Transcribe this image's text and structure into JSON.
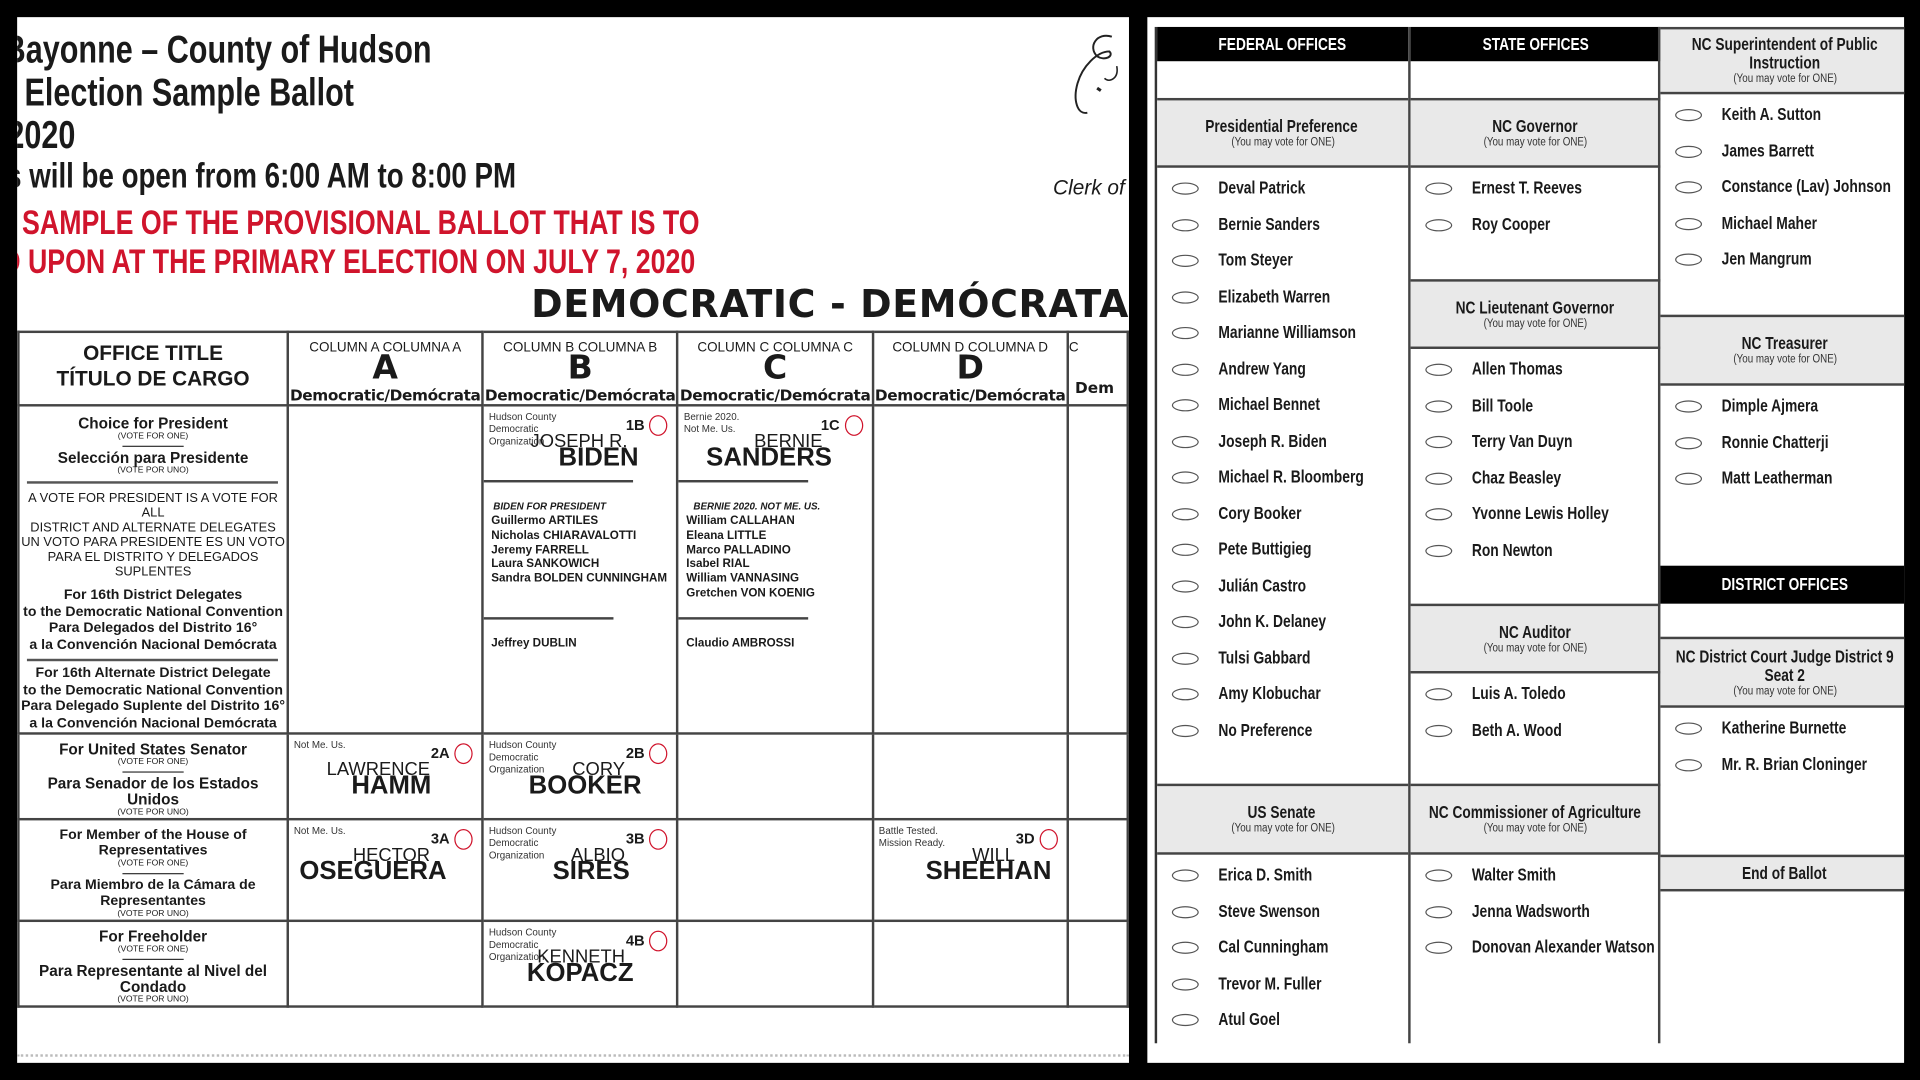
{
  "document_header": {
    "title_line_1": "Bayonne – County of Hudson",
    "title_line_2": "Election Sample Ballot",
    "title_line_3": "2020",
    "polls_line": "s will be open from 6:00 AM to 8:00 PM",
    "notice_line_1": "SAMPLE OF THE PROVISIONAL BALLOT THAT IS TO",
    "notice_line_2": "D UPON AT THE PRIMARY ELECTION ON JULY 7, 2020",
    "party_banner": "DEMOCRATIC - DEMÓCRATA",
    "clerk_label": "Clerk of",
    "signature": "E"
  },
  "colors": {
    "notice_red": "#d0142c",
    "header_black": "#000000",
    "section_gray": "#e9e9e9"
  },
  "nj_ballot": {
    "office_header": [
      "OFFICE TITLE",
      "TÍTULO DE CARGO"
    ],
    "columns": [
      {
        "label": "COLUMN A COLUMNA A",
        "letter": "A",
        "party": "Democratic/Demócrata"
      },
      {
        "label": "COLUMN B COLUMNA B",
        "letter": "B",
        "party": "Democratic/Demócrata"
      },
      {
        "label": "COLUMN C COLUMNA C",
        "letter": "C",
        "party": "Democratic/Demócrata"
      },
      {
        "label": "COLUMN D COLUMNA D",
        "letter": "D",
        "party": "Democratic/Demócrata"
      },
      {
        "label": "C",
        "letter": "",
        "party": "Dem"
      }
    ],
    "president": {
      "title_en": "Choice for President",
      "vote_en": "(VOTE FOR ONE)",
      "title_es": "Selección para Presidente",
      "vote_es": "(VOTE POR UNO)",
      "notice": [
        "A VOTE FOR PRESIDENT IS A VOTE FOR ALL",
        "DISTRICT AND ALTERNATE DELEGATES",
        "UN VOTO PARA PRESIDENTE ES UN VOTO",
        "PARA EL DISTRITO Y DELEGADOS SUPLENTES"
      ],
      "delegates": [
        "For 16th District Delegates",
        "to the Democratic National Convention",
        "Para Delegados del Distrito 16°",
        "a la Convención Nacional Demócrata"
      ],
      "alternates": [
        "For 16th Alternate District Delegate",
        "to the Democratic National Convention",
        "Para Delegado Suplente del Distrito 16°",
        "a la Convención Nacional Demócrata"
      ],
      "biden": {
        "slogan": [
          "Hudson County",
          "Democratic",
          "Organization"
        ],
        "number": "1B",
        "first": "JOSEPH R.",
        "last": "BIDEN",
        "slate_title": "BIDEN FOR PRESIDENT",
        "delegates": [
          "Guillermo ARTILES",
          "Nicholas CHIARAVALOTTI",
          "Jeremy FARRELL",
          "Laura SANKOWICH",
          "Sandra BOLDEN CUNNINGHAM"
        ],
        "alternate": "Jeffrey DUBLIN"
      },
      "sanders": {
        "slogan": [
          "Bernie 2020.",
          "Not Me. Us."
        ],
        "number": "1C",
        "first": "BERNIE",
        "last": "SANDERS",
        "slate_title": "BERNIE 2020. NOT ME. US.",
        "delegates": [
          "William CALLAHAN",
          "Eleana LITTLE",
          "Marco PALLADINO",
          "Isabel RIAL",
          "William VANNASING",
          "Gretchen VON KOENIG"
        ],
        "alternate": "Claudio AMBROSSI"
      }
    },
    "senator": {
      "title_en": "For United States Senator",
      "vote_en": "(VOTE FOR ONE)",
      "title_es": "Para Senador de los Estados Unidos",
      "vote_es": "(VOTE POR UNO)",
      "a": {
        "slogan": [
          "Not Me. Us."
        ],
        "number": "2A",
        "first": "LAWRENCE",
        "last": "HAMM"
      },
      "b": {
        "slogan": [
          "Hudson County",
          "Democratic",
          "Organization"
        ],
        "number": "2B",
        "first": "CORY",
        "last": "BOOKER"
      }
    },
    "house": {
      "title_en": "For Member of the House of Representatives",
      "vote_en": "(VOTE FOR ONE)",
      "title_es": "Para Miembro de la Cámara de Representantes",
      "vote_es": "(VOTE POR UNO)",
      "a": {
        "slogan": [
          "Not Me. Us."
        ],
        "number": "3A",
        "first": "HECTOR",
        "last": "OSEGUERA"
      },
      "b": {
        "slogan": [
          "Hudson County",
          "Democratic",
          "Organization"
        ],
        "number": "3B",
        "first": "ALBIO",
        "last": "SIRES"
      },
      "d": {
        "slogan": [
          "Battle Tested.",
          "Mission Ready."
        ],
        "number": "3D",
        "first": "WILL",
        "last": "SHEEHAN"
      }
    },
    "freeholder": {
      "title_en": "For Freeholder",
      "vote_en": "(VOTE FOR ONE)",
      "title_es": "Para Representante al Nivel del Condado",
      "vote_es": "(VOTE POR UNO)",
      "b": {
        "slogan": [
          "Hudson County",
          "Democratic",
          "Organization"
        ],
        "number": "4B",
        "first": "KENNETH",
        "last": "KOPACZ"
      }
    }
  },
  "nc_ballot": {
    "vote_note": "(You may vote for ONE)",
    "columns": [
      {
        "sections": [
          {
            "type": "black",
            "title": "FEDERAL OFFICES"
          },
          {
            "type": "blank"
          },
          {
            "type": "office",
            "title": "Presidential Preference",
            "candidates": [
              "Deval Patrick",
              "Bernie Sanders",
              "Tom Steyer",
              "Elizabeth Warren",
              "Marianne Williamson",
              "Andrew Yang",
              "Michael Bennet",
              "Joseph R. Biden",
              "Michael R. Bloomberg",
              "Cory Booker",
              "Pete Buttigieg",
              "Julián Castro",
              "John K. Delaney",
              "Tulsi Gabbard",
              "Amy Klobuchar",
              "No Preference"
            ]
          },
          {
            "type": "office",
            "title": "US Senate",
            "candidates": [
              "Erica D. Smith",
              "Steve Swenson",
              "Cal Cunningham",
              "Trevor M. Fuller",
              "Atul Goel"
            ]
          }
        ]
      },
      {
        "sections": [
          {
            "type": "black",
            "title": "STATE OFFICES"
          },
          {
            "type": "blank"
          },
          {
            "type": "office",
            "title": "NC Governor",
            "candidates": [
              "Ernest T. Reeves",
              "Roy Cooper"
            ]
          },
          {
            "type": "office",
            "title": "NC Lieutenant Governor",
            "candidates": [
              "Allen Thomas",
              "Bill Toole",
              "Terry Van Duyn",
              "Chaz Beasley",
              "Yvonne Lewis Holley",
              "Ron Newton"
            ]
          },
          {
            "type": "office",
            "title": "NC Auditor",
            "candidates": [
              "Luis A. Toledo",
              "Beth A. Wood"
            ]
          },
          {
            "type": "office",
            "title": "NC Commissioner of Agriculture",
            "candidates": [
              "Walter Smith",
              "Jenna Wadsworth",
              "Donovan Alexander Watson"
            ]
          }
        ]
      },
      {
        "sections": [
          {
            "type": "office",
            "title": "NC Superintendent of Public Instruction",
            "candidates": [
              "Keith A. Sutton",
              "James Barrett",
              "Constance (Lav) Johnson",
              "Michael Maher",
              "Jen Mangrum"
            ]
          },
          {
            "type": "office",
            "title": "NC Treasurer",
            "candidates": [
              "Dimple Ajmera",
              "Ronnie Chatterji",
              "Matt Leatherman"
            ]
          },
          {
            "type": "black",
            "title": "DISTRICT OFFICES"
          },
          {
            "type": "blank"
          },
          {
            "type": "office",
            "title": "NC District Court Judge District 9 Seat 2",
            "candidates": [
              "Katherine Burnette",
              "Mr. R. Brian Cloninger"
            ]
          },
          {
            "type": "end",
            "title": "End of Ballot"
          }
        ]
      }
    ]
  }
}
